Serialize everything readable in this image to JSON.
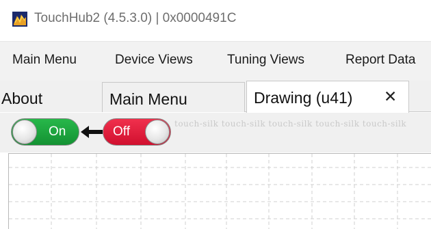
{
  "window": {
    "title": "TouchHub2 (4.5.3.0) | 0x0000491C",
    "app_icon": "touchhub-app-icon"
  },
  "menubar": {
    "items": [
      {
        "label": "Main Menu"
      },
      {
        "label": "Device Views"
      },
      {
        "label": "Tuning Views"
      },
      {
        "label": "Report Data"
      }
    ]
  },
  "tabs": {
    "items": [
      {
        "label": "About"
      },
      {
        "label": "Main Menu"
      },
      {
        "label": "Drawing (u41)",
        "active": true,
        "close_glyph": "✕"
      }
    ]
  },
  "toolbar": {
    "toggle_on": {
      "label": "On",
      "color": "#1fa843"
    },
    "toggle_off": {
      "label": "Off",
      "color": "#e81f3f"
    },
    "link_icon": "arrow-left-icon",
    "watermark_text": "touch-silk  touch-silk  touch-silk  touch-silk  touch-silk"
  },
  "colors": {
    "menubar_bg": "#f2f2f2",
    "tab_border": "#c8c8c8",
    "grid_line": "#cfcfcf"
  }
}
